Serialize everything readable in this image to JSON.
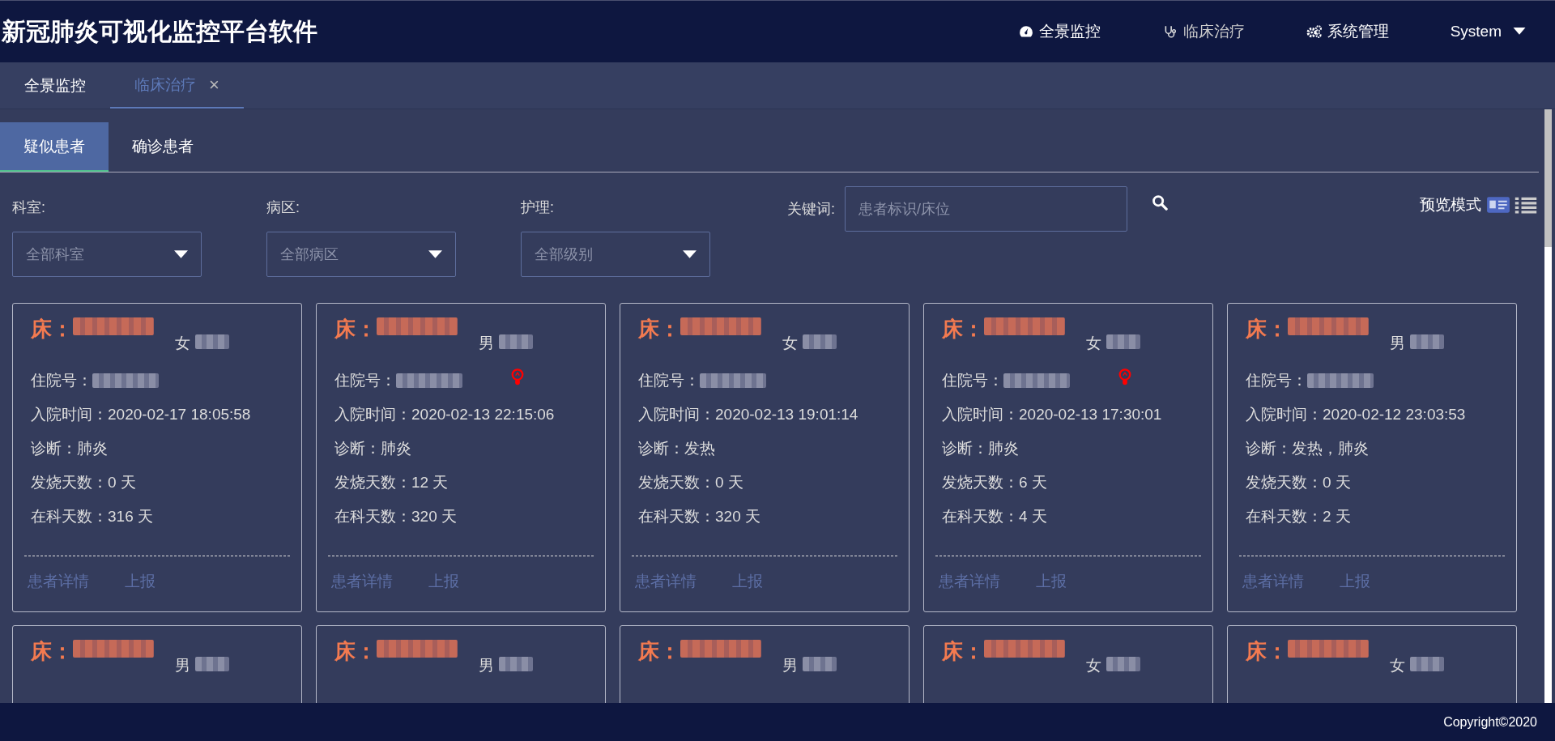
{
  "header": {
    "title": "新冠肺炎可视化监控平台软件",
    "nav": [
      {
        "label": "全景监控"
      },
      {
        "label": "临床治疗"
      },
      {
        "label": "系统管理"
      }
    ],
    "user": "System"
  },
  "tabs": [
    {
      "label": "全景监控",
      "selected": false
    },
    {
      "label": "临床治疗",
      "selected": true,
      "close": "×"
    }
  ],
  "subtabs": [
    {
      "label": "疑似患者",
      "selected": true
    },
    {
      "label": "确诊患者",
      "selected": false
    }
  ],
  "filters": [
    {
      "label": "科室:",
      "placeholder": "全部科室"
    },
    {
      "label": "病区:",
      "placeholder": "全部病区"
    },
    {
      "label": "护理:",
      "placeholder": "全部级别"
    }
  ],
  "keyword": {
    "label": "关键词:",
    "placeholder": "患者标识/床位"
  },
  "view_mode": {
    "label": "预览模式",
    "options": [
      {
        "selected": true
      },
      {
        "selected": false
      }
    ]
  },
  "cards": [
    {
      "bed_label": "床：",
      "gender": "女",
      "alert": false,
      "fields": [
        {
          "label": "住院号：",
          "kind": "redacted"
        },
        {
          "label": "入院时间：",
          "value": "2020-02-17 18:05:58",
          "kind": "text"
        },
        {
          "label": "诊断：",
          "value": "肺炎",
          "kind": "text"
        },
        {
          "label": "发烧天数：",
          "value": "0 天",
          "kind": "text"
        },
        {
          "label": "在科天数：",
          "value": "316 天",
          "kind": "text"
        }
      ],
      "actions": [
        "患者详情",
        "上报"
      ]
    },
    {
      "bed_label": "床：",
      "gender": "男",
      "alert": true,
      "fields": [
        {
          "label": "住院号：",
          "kind": "redacted"
        },
        {
          "label": "入院时间：",
          "value": "2020-02-13 22:15:06",
          "kind": "text"
        },
        {
          "label": "诊断：",
          "value": "肺炎",
          "kind": "text"
        },
        {
          "label": "发烧天数：",
          "value": "12 天",
          "kind": "text"
        },
        {
          "label": "在科天数：",
          "value": "320 天",
          "kind": "text"
        }
      ],
      "actions": [
        "患者详情",
        "上报"
      ]
    },
    {
      "bed_label": "床：",
      "gender": "女",
      "alert": false,
      "fields": [
        {
          "label": "住院号：",
          "kind": "redacted"
        },
        {
          "label": "入院时间：",
          "value": "2020-02-13 19:01:14",
          "kind": "text"
        },
        {
          "label": "诊断：",
          "value": "发热",
          "kind": "text"
        },
        {
          "label": "发烧天数：",
          "value": "0 天",
          "kind": "text"
        },
        {
          "label": "在科天数：",
          "value": "320 天",
          "kind": "text"
        }
      ],
      "actions": [
        "患者详情",
        "上报"
      ]
    },
    {
      "bed_label": "床：",
      "gender": "女",
      "alert": true,
      "fields": [
        {
          "label": "住院号：",
          "kind": "redacted"
        },
        {
          "label": "入院时间：",
          "value": "2020-02-13 17:30:01",
          "kind": "text"
        },
        {
          "label": "诊断：",
          "value": "肺炎",
          "kind": "text"
        },
        {
          "label": "发烧天数：",
          "value": "6 天",
          "kind": "text"
        },
        {
          "label": "在科天数：",
          "value": "4 天",
          "kind": "text"
        }
      ],
      "actions": [
        "患者详情",
        "上报"
      ]
    },
    {
      "bed_label": "床：",
      "gender": "男",
      "alert": false,
      "fields": [
        {
          "label": "住院号：",
          "kind": "redacted"
        },
        {
          "label": "入院时间：",
          "value": "2020-02-12 23:03:53",
          "kind": "text"
        },
        {
          "label": "诊断：",
          "value": "发热，肺炎",
          "kind": "text"
        },
        {
          "label": "发烧天数：",
          "value": "0 天",
          "kind": "text"
        },
        {
          "label": "在科天数：",
          "value": "2 天",
          "kind": "text"
        }
      ],
      "actions": [
        "患者详情",
        "上报"
      ]
    },
    {
      "bed_label": "床：",
      "gender": "男"
    },
    {
      "bed_label": "床：",
      "gender": "男"
    },
    {
      "bed_label": "床：",
      "gender": "男"
    },
    {
      "bed_label": "床：",
      "gender": "女"
    },
    {
      "bed_label": "床：",
      "gender": "女"
    }
  ],
  "footer": "Copyright©2020"
}
